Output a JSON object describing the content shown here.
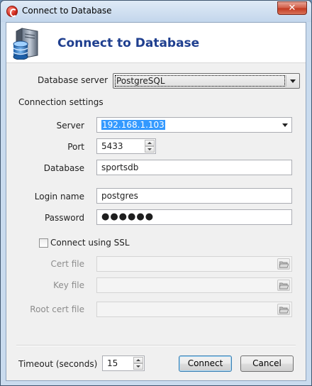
{
  "window": {
    "title": "Connect to Database",
    "close_glyph": "✕"
  },
  "header": {
    "title": "Connect to Database",
    "icon": "database-server-icon"
  },
  "database_server": {
    "label": "Database server",
    "value": "PostgreSQL"
  },
  "connection_settings": {
    "heading": "Connection settings",
    "server": {
      "label": "Server",
      "value": "192.168.1.103"
    },
    "port": {
      "label": "Port",
      "value": "5433"
    },
    "database": {
      "label": "Database",
      "value": "sportsdb"
    },
    "login_name": {
      "label": "Login name",
      "value": "postgres"
    },
    "password": {
      "label": "Password",
      "value": "●●●●●●"
    }
  },
  "ssl": {
    "checkbox_label": "Connect using SSL",
    "checked": false,
    "cert_file": {
      "label": "Cert file",
      "value": ""
    },
    "key_file": {
      "label": "Key file",
      "value": ""
    },
    "root_cert_file": {
      "label": "Root cert file",
      "value": ""
    }
  },
  "footer": {
    "timeout_label": "Timeout (seconds)",
    "timeout_value": "15",
    "connect_label": "Connect",
    "cancel_label": "Cancel"
  },
  "colors": {
    "header_title": "#1f3f8f",
    "selection": "#3399ff",
    "title_bar": "#c3d6ec"
  }
}
